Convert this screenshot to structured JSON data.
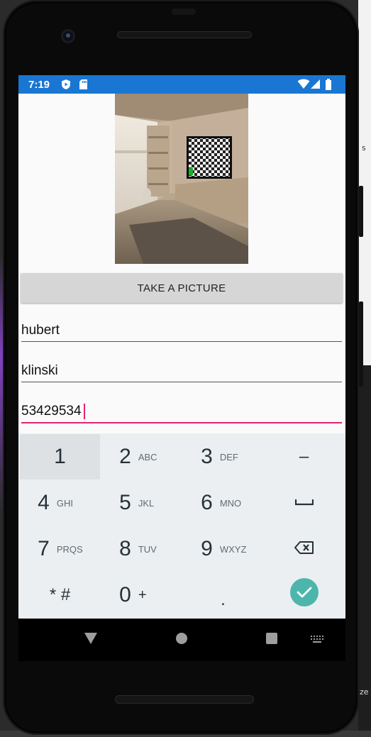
{
  "status_bar": {
    "time": "7:19",
    "icons": [
      "play-protect-icon",
      "sd-card-icon",
      "wifi-icon",
      "signal-icon",
      "battery-icon"
    ],
    "background": "#1976d2"
  },
  "photo": {
    "description_icon": "room-photo-with-tv"
  },
  "take_picture_button": {
    "label": "TAKE A PICTURE"
  },
  "form": {
    "first_name": "hubert",
    "last_name": "klinski",
    "phone": "53429534"
  },
  "keypad": {
    "rows": [
      [
        {
          "main": "1",
          "sub": ""
        },
        {
          "main": "2",
          "sub": "ABC"
        },
        {
          "main": "3",
          "sub": "DEF"
        },
        {
          "main": "–",
          "sub": ""
        }
      ],
      [
        {
          "main": "4",
          "sub": "GHI"
        },
        {
          "main": "5",
          "sub": "JKL"
        },
        {
          "main": "6",
          "sub": "MNO"
        },
        {
          "main": "",
          "sub": ""
        }
      ],
      [
        {
          "main": "7",
          "sub": "PRQS"
        },
        {
          "main": "8",
          "sub": "TUV"
        },
        {
          "main": "9",
          "sub": "WXYZ"
        },
        {
          "main": "",
          "sub": ""
        }
      ],
      [
        {
          "main": "* #",
          "sub": ""
        },
        {
          "main": "0",
          "sub": "+"
        },
        {
          "main": ".",
          "sub": ""
        },
        {
          "main": "",
          "sub": ""
        }
      ]
    ],
    "accent": "#4db6ac"
  },
  "nav_bar": {
    "icons": [
      "back-triangle-icon",
      "home-circle-icon",
      "recents-square-icon",
      "keyboard-switch-icon"
    ]
  },
  "edge_text": {
    "top_right": "s",
    "bottom_right": "ze"
  },
  "colors": {
    "focus_underline": "#e0256f",
    "keypad_bg": "#eceff1"
  }
}
